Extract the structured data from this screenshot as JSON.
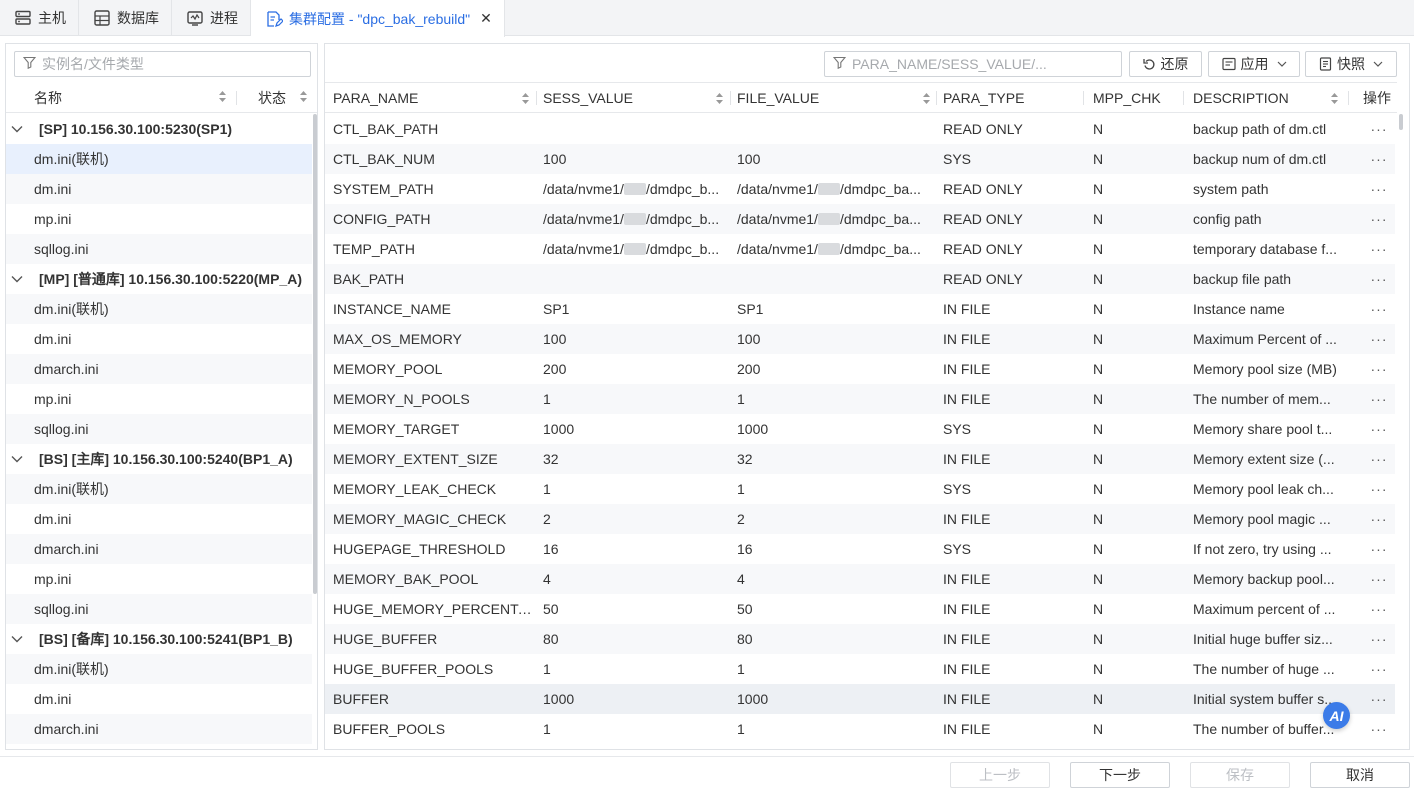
{
  "tabs": [
    {
      "label": "主机",
      "icon": "host-icon"
    },
    {
      "label": "数据库",
      "icon": "database-icon"
    },
    {
      "label": "进程",
      "icon": "process-icon"
    },
    {
      "label": "集群配置 - \"dpc_bak_rebuild\"",
      "icon": "config-edit-icon",
      "active": true
    }
  ],
  "left": {
    "search_placeholder": "实例名/文件类型",
    "col_name": "名称",
    "col_status": "状态",
    "tree": [
      {
        "type": "group",
        "label": "[SP] 10.156.30.100:5230(SP1)"
      },
      {
        "type": "leaf",
        "label": "dm.ini(联机)",
        "selected": true
      },
      {
        "type": "leaf",
        "label": "dm.ini"
      },
      {
        "type": "leaf",
        "label": "mp.ini"
      },
      {
        "type": "leaf",
        "label": "sqllog.ini"
      },
      {
        "type": "group",
        "label": "[MP] [普通库] 10.156.30.100:5220(MP_A)"
      },
      {
        "type": "leaf",
        "label": "dm.ini(联机)"
      },
      {
        "type": "leaf",
        "label": "dm.ini"
      },
      {
        "type": "leaf",
        "label": "dmarch.ini"
      },
      {
        "type": "leaf",
        "label": "mp.ini"
      },
      {
        "type": "leaf",
        "label": "sqllog.ini"
      },
      {
        "type": "group",
        "label": "[BS] [主库] 10.156.30.100:5240(BP1_A)"
      },
      {
        "type": "leaf",
        "label": "dm.ini(联机)"
      },
      {
        "type": "leaf",
        "label": "dm.ini"
      },
      {
        "type": "leaf",
        "label": "dmarch.ini"
      },
      {
        "type": "leaf",
        "label": "mp.ini"
      },
      {
        "type": "leaf",
        "label": "sqllog.ini"
      },
      {
        "type": "group",
        "label": "[BS] [备库] 10.156.30.100:5241(BP1_B)"
      },
      {
        "type": "leaf",
        "label": "dm.ini(联机)"
      },
      {
        "type": "leaf",
        "label": "dm.ini"
      },
      {
        "type": "leaf",
        "label": "dmarch.ini"
      }
    ]
  },
  "right": {
    "search_placeholder": "PARA_NAME/SESS_VALUE/...",
    "restore_label": "还原",
    "apply_label": "应用",
    "snapshot_label": "快照",
    "columns": [
      "PARA_NAME",
      "SESS_VALUE",
      "FILE_VALUE",
      "PARA_TYPE",
      "MPP_CHK",
      "DESCRIPTION",
      "操作"
    ],
    "path_prefix": "/data/nvme1/",
    "sess_path_suffix": "/dmdpc_b...",
    "file_path_suffix": "/dmdpc_ba...",
    "more_label": "···",
    "rows": [
      {
        "name": "CTL_BAK_PATH",
        "sess": "",
        "file": "",
        "type": "READ ONLY",
        "mpp": "N",
        "desc": "backup path of dm.ctl"
      },
      {
        "name": "CTL_BAK_NUM",
        "sess": "100",
        "file": "100",
        "type": "SYS",
        "mpp": "N",
        "desc": "backup num of dm.ctl"
      },
      {
        "name": "SYSTEM_PATH",
        "path": true,
        "type": "READ ONLY",
        "mpp": "N",
        "desc": "system path"
      },
      {
        "name": "CONFIG_PATH",
        "path": true,
        "type": "READ ONLY",
        "mpp": "N",
        "desc": "config path"
      },
      {
        "name": "TEMP_PATH",
        "path": true,
        "type": "READ ONLY",
        "mpp": "N",
        "desc": "temporary database f..."
      },
      {
        "name": "BAK_PATH",
        "sess": "",
        "file": "",
        "type": "READ ONLY",
        "mpp": "N",
        "desc": "backup file path"
      },
      {
        "name": "INSTANCE_NAME",
        "sess": "SP1",
        "file": "SP1",
        "type": "IN FILE",
        "mpp": "N",
        "desc": "Instance name"
      },
      {
        "name": "MAX_OS_MEMORY",
        "sess": "100",
        "file": "100",
        "type": "IN FILE",
        "mpp": "N",
        "desc": "Maximum Percent of ..."
      },
      {
        "name": "MEMORY_POOL",
        "sess": "200",
        "file": "200",
        "type": "IN FILE",
        "mpp": "N",
        "desc": "Memory pool size (MB)"
      },
      {
        "name": "MEMORY_N_POOLS",
        "sess": "1",
        "file": "1",
        "type": "IN FILE",
        "mpp": "N",
        "desc": "The number of mem..."
      },
      {
        "name": "MEMORY_TARGET",
        "sess": "1000",
        "file": "1000",
        "type": "SYS",
        "mpp": "N",
        "desc": "Memory share pool t..."
      },
      {
        "name": "MEMORY_EXTENT_SIZE",
        "sess": "32",
        "file": "32",
        "type": "IN FILE",
        "mpp": "N",
        "desc": "Memory extent size (..."
      },
      {
        "name": "MEMORY_LEAK_CHECK",
        "sess": "1",
        "file": "1",
        "type": "SYS",
        "mpp": "N",
        "desc": "Memory pool leak ch..."
      },
      {
        "name": "MEMORY_MAGIC_CHECK",
        "sess": "2",
        "file": "2",
        "type": "IN FILE",
        "mpp": "N",
        "desc": "Memory pool magic ..."
      },
      {
        "name": "HUGEPAGE_THRESHOLD",
        "sess": "16",
        "file": "16",
        "type": "SYS",
        "mpp": "N",
        "desc": "If not zero, try using ..."
      },
      {
        "name": "MEMORY_BAK_POOL",
        "sess": "4",
        "file": "4",
        "type": "IN FILE",
        "mpp": "N",
        "desc": "Memory backup pool..."
      },
      {
        "name": "HUGE_MEMORY_PERCENTAGE",
        "sess": "50",
        "file": "50",
        "type": "IN FILE",
        "mpp": "N",
        "desc": "Maximum percent of ..."
      },
      {
        "name": "HUGE_BUFFER",
        "sess": "80",
        "file": "80",
        "type": "IN FILE",
        "mpp": "N",
        "desc": "Initial huge buffer siz..."
      },
      {
        "name": "HUGE_BUFFER_POOLS",
        "sess": "1",
        "file": "1",
        "type": "IN FILE",
        "mpp": "N",
        "desc": "The number of huge ..."
      },
      {
        "name": "BUFFER",
        "sess": "1000",
        "file": "1000",
        "type": "IN FILE",
        "mpp": "N",
        "desc": "Initial system buffer s...",
        "highlight": true
      },
      {
        "name": "BUFFER_POOLS",
        "sess": "1",
        "file": "1",
        "type": "IN FILE",
        "mpp": "N",
        "desc": "The number of buffer..."
      }
    ]
  },
  "ai_label": "AI",
  "footer": {
    "prev": "上一步",
    "next": "下一步",
    "save": "保存",
    "cancel": "取消"
  }
}
